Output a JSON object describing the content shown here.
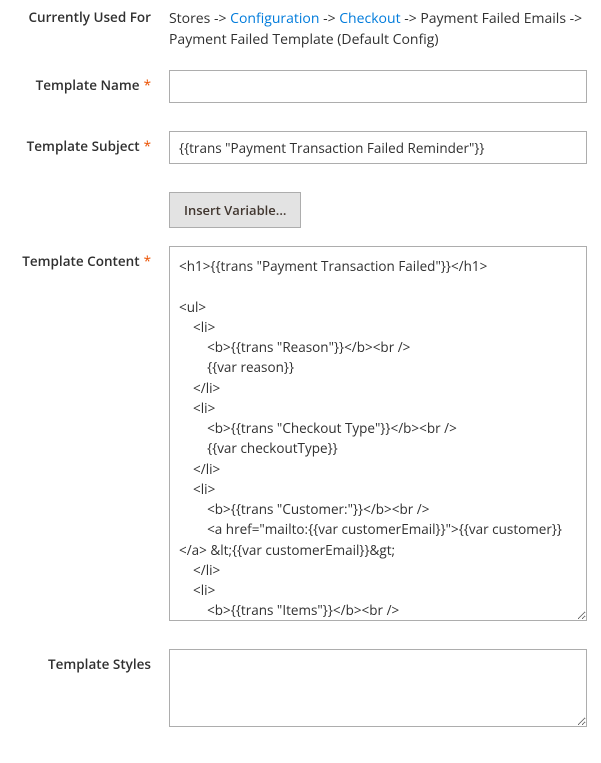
{
  "labels": {
    "currentlyUsedFor": "Currently Used For",
    "templateName": "Template Name",
    "templateSubject": "Template Subject",
    "templateContent": "Template Content",
    "templateStyles": "Template Styles"
  },
  "breadcrumb": {
    "prefix": "Stores -> ",
    "link1": "Configuration",
    "sep1": " -> ",
    "link2": "Checkout",
    "sep2": " -> Payment Failed Emails -> Payment Failed Template  (Default Config)"
  },
  "fields": {
    "templateName": "",
    "templateSubject": "{{trans \"Payment Transaction Failed Reminder\"}}",
    "templateContent": "<h1>{{trans \"Payment Transaction Failed\"}}</h1>\n\n<ul>\n    <li>\n        <b>{{trans \"Reason\"}}</b><br />\n        {{var reason}}\n    </li>\n    <li>\n        <b>{{trans \"Checkout Type\"}}</b><br />\n        {{var checkoutType}}\n    </li>\n    <li>\n        <b>{{trans \"Customer:\"}}</b><br />\n        <a href=\"mailto:{{var customerEmail}}\">{{var customer}}</a> &lt;{{var customerEmail}}&gt;\n    </li>\n    <li>\n        <b>{{trans \"Items\"}}</b><br />\n        {{var items|raw}}\n    </li>\n    <li>\n",
    "templateStyles": ""
  },
  "buttons": {
    "insertVariable": "Insert Variable..."
  }
}
